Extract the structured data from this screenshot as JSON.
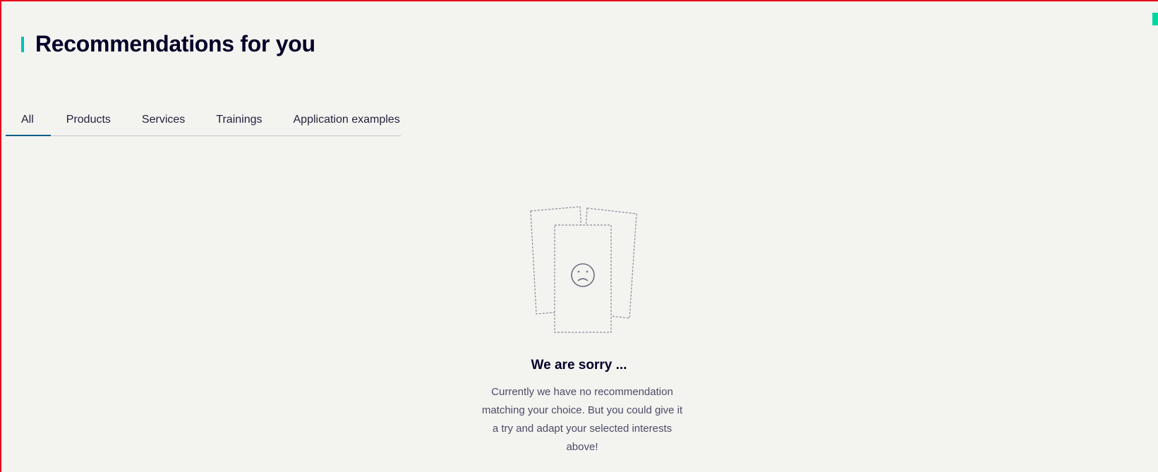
{
  "section": {
    "title": "Recommendations for you"
  },
  "tabs": [
    {
      "label": "All",
      "active": true
    },
    {
      "label": "Products",
      "active": false
    },
    {
      "label": "Services",
      "active": false
    },
    {
      "label": "Trainings",
      "active": false
    },
    {
      "label": "Application examples",
      "active": false
    }
  ],
  "empty_state": {
    "icon": "sad-face-icon",
    "title": "We are sorry ...",
    "message": "Currently we have no recommendation matching your choice. But you could give it a try and adapt your selected interests above!"
  },
  "colors": {
    "accent": "#00c1b8",
    "title": "#000028",
    "active_tab_underline": "#005f87",
    "background": "#f3f3f0"
  }
}
